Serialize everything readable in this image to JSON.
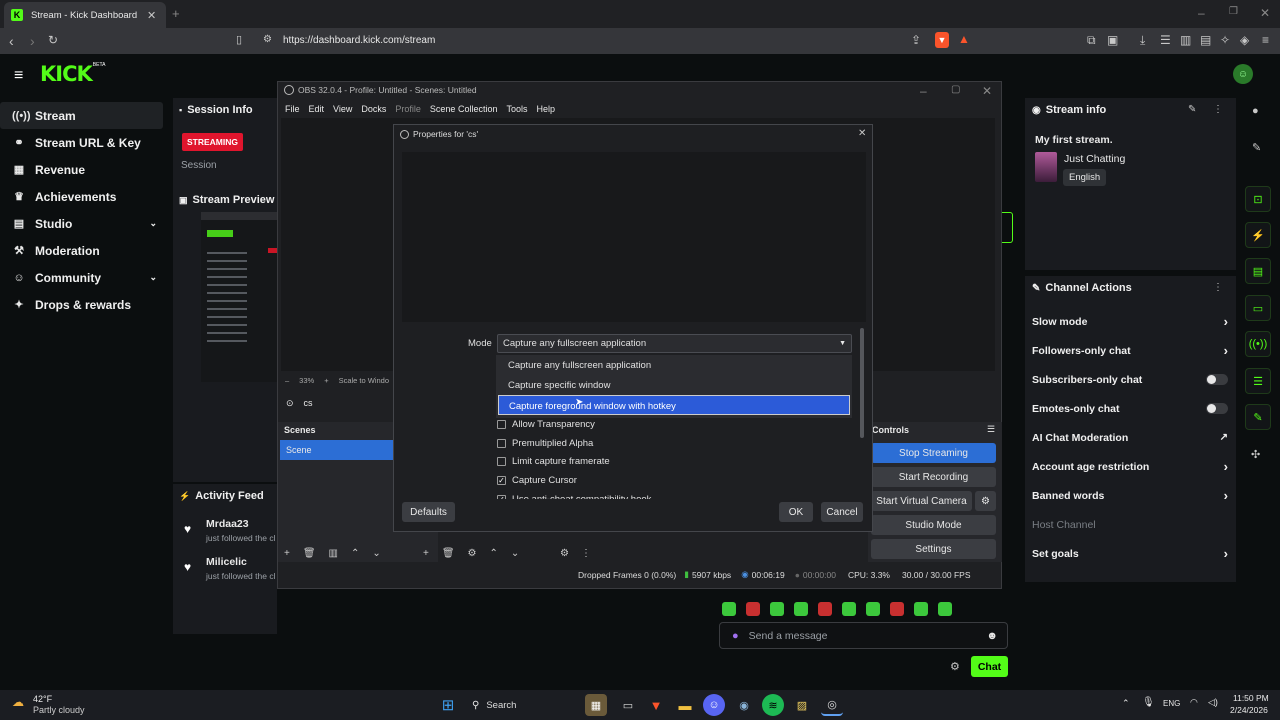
{
  "browser": {
    "tab_title": "Stream - Kick Dashboard",
    "url": "https://dashboard.kick.com/stream"
  },
  "kick": {
    "logo": "KICK",
    "logo_sup": "BETA",
    "sidebar": [
      {
        "label": "Stream",
        "icon": "broadcast-icon"
      },
      {
        "label": "Stream URL & Key",
        "icon": "link-icon"
      },
      {
        "label": "Revenue",
        "icon": "revenue-icon"
      },
      {
        "label": "Achievements",
        "icon": "trophy-icon"
      },
      {
        "label": "Studio",
        "icon": "studio-icon"
      },
      {
        "label": "Moderation",
        "icon": "hammer-icon"
      },
      {
        "label": "Community",
        "icon": "users-icon"
      },
      {
        "label": "Drops & rewards",
        "icon": "gift-icon"
      }
    ],
    "session_info": {
      "title": "Session Info",
      "badge": "STREAMING",
      "session": "Session"
    },
    "stream_preview": {
      "title": "Stream Preview"
    },
    "activity_feed": {
      "title": "Activity Feed",
      "items": [
        {
          "user": "Mrdaa23",
          "text": "just followed the cl"
        },
        {
          "user": "Milicelic",
          "text": "just followed the cl"
        }
      ]
    },
    "stream_info": {
      "title": "Stream info",
      "stream_title": "My first stream.",
      "category": "Just Chatting",
      "language": "English"
    },
    "channel_actions": {
      "title": "Channel Actions",
      "items": [
        {
          "label": "Slow mode",
          "control": "chevron"
        },
        {
          "label": "Followers-only chat",
          "control": "chevron"
        },
        {
          "label": "Subscribers-only chat",
          "control": "toggle"
        },
        {
          "label": "Emotes-only chat",
          "control": "toggle"
        },
        {
          "label": "AI Chat Moderation",
          "control": "external"
        },
        {
          "label": "Account age restriction",
          "control": "chevron"
        },
        {
          "label": "Banned words",
          "control": "chevron"
        },
        {
          "label": "Host Channel",
          "control": "none"
        },
        {
          "label": "Set goals",
          "control": "chevron"
        }
      ]
    },
    "chat": {
      "placeholder": "Send a message",
      "button": "Chat"
    }
  },
  "obs": {
    "title": "OBS 32.0.4 - Profile: Untitled - Scenes: Untitled",
    "menu": [
      "File",
      "Edit",
      "View",
      "Docks",
      "Profile",
      "Scene Collection",
      "Tools",
      "Help"
    ],
    "zoom": "33%",
    "scale": "Scale to Windo",
    "source_name": "cs",
    "scenes_title": "Scenes",
    "scene_item": "Scene",
    "controls_title": "Controls",
    "controls": [
      "Stop Streaming",
      "Start Recording",
      "Start Virtual Camera",
      "Studio Mode",
      "Settings"
    ],
    "status": {
      "dropped": "Dropped Frames 0 (0.0%)",
      "kbps": "5907 kbps",
      "stream_time": "00:06:19",
      "rec_time": "00:00:00",
      "cpu": "CPU: 3.3%",
      "fps": "30.00 / 30.00 FPS"
    }
  },
  "dialog": {
    "title": "Properties for 'cs'",
    "mode_label": "Mode",
    "mode_value": "Capture any fullscreen application",
    "options": [
      "Capture any fullscreen application",
      "Capture specific window",
      "Capture foreground window with hotkey"
    ],
    "selected_option_index": 2,
    "checkboxes": [
      {
        "label": "Allow Transparency",
        "checked": false
      },
      {
        "label": "Premultiplied Alpha",
        "checked": false
      },
      {
        "label": "Limit capture framerate",
        "checked": false
      },
      {
        "label": "Capture Cursor",
        "checked": true
      },
      {
        "label": "Use anti-cheat compatibility hook",
        "checked": true
      }
    ],
    "defaults": "Defaults",
    "ok": "OK",
    "cancel": "Cancel"
  },
  "taskbar": {
    "weather_temp": "42°F",
    "weather_desc": "Partly cloudy",
    "search": "Search",
    "lang": "ENG",
    "time": "11:50 PM",
    "date": "2/24/2026"
  }
}
